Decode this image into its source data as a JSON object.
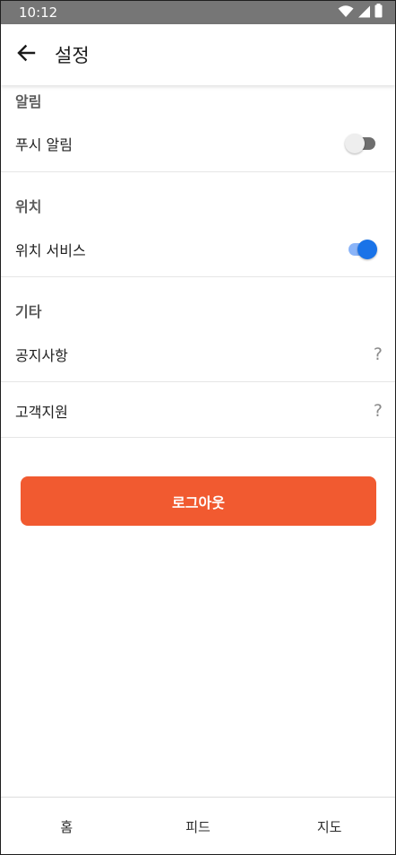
{
  "status_bar": {
    "time": "10:12",
    "icons": [
      "wifi-icon",
      "signal-icon",
      "battery-icon"
    ],
    "background": "#767676"
  },
  "app_bar": {
    "back_icon": "arrow-left-icon",
    "title": "설정"
  },
  "sections": {
    "notifications": {
      "header": "알림",
      "push_label": "푸시 알림",
      "push_enabled": false
    },
    "location": {
      "header": "위치",
      "service_label": "위치 서비스",
      "service_enabled": true
    },
    "other": {
      "header": "기타",
      "notice_label": "공지사항",
      "notice_chevron": "?",
      "support_label": "고객지원",
      "support_chevron": "?"
    }
  },
  "logout": {
    "label": "로그아웃",
    "color": "#f15a30"
  },
  "bottom_nav": {
    "home": "홈",
    "feed": "피드",
    "map": "지도"
  },
  "colors": {
    "toggle_on": "#1a73e8",
    "toggle_off": "#6e6e6e"
  }
}
